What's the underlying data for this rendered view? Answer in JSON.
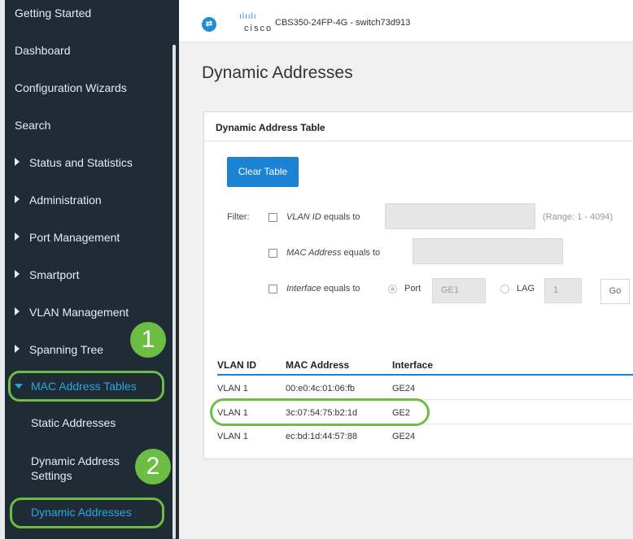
{
  "sidebar": {
    "items": [
      {
        "label": "Getting Started"
      },
      {
        "label": "Dashboard"
      },
      {
        "label": "Configuration Wizards"
      },
      {
        "label": "Search"
      },
      {
        "label": "Status and Statistics"
      },
      {
        "label": "Administration"
      },
      {
        "label": "Port Management"
      },
      {
        "label": "Smartport"
      },
      {
        "label": "VLAN Management"
      },
      {
        "label": "Spanning Tree"
      },
      {
        "label": "MAC Address Tables"
      },
      {
        "label": "Static Addresses"
      },
      {
        "label": "Dynamic Address"
      },
      {
        "label": "Settings"
      },
      {
        "label": "Dynamic Addresses"
      }
    ]
  },
  "annotations": {
    "step1": "1",
    "step2": "2",
    "highlight_color": "#6dbd45"
  },
  "topbar": {
    "logo_icon": "switch-logo-icon",
    "brand": "cisco",
    "brand_bars": "ılıılı",
    "device": "CBS350-24FP-4G - switch73d913"
  },
  "main": {
    "page_title": "Dynamic Addresses",
    "panel_title": "Dynamic Address Table",
    "clear_button": "Clear Table",
    "filter": {
      "label": "Filter:",
      "vlan_name": "VLAN ID",
      "vlan_cond": "equals to",
      "vlan_range": "(Range: 1 - 4094)",
      "mac_name": "MAC Address",
      "mac_cond": "equals to",
      "iface_name": "Interface",
      "iface_cond": "equals to",
      "port_label": "Port",
      "port_value": "GE1",
      "lag_label": "LAG",
      "lag_value": "1",
      "go_label": "Go"
    },
    "table": {
      "headers": [
        "VLAN ID",
        "MAC Address",
        "Interface"
      ],
      "rows": [
        [
          "VLAN 1",
          "00:e0:4c:01:06:fb",
          "GE24"
        ],
        [
          "VLAN 1",
          "3c:07:54:75:b2:1d",
          "GE2"
        ],
        [
          "VLAN 1",
          "ec:bd:1d:44:57:88",
          "GE24"
        ]
      ]
    }
  },
  "colors": {
    "sidebar_bg": "#1f2b35",
    "accent": "#1c82d4",
    "active_link": "#29a8e0"
  }
}
